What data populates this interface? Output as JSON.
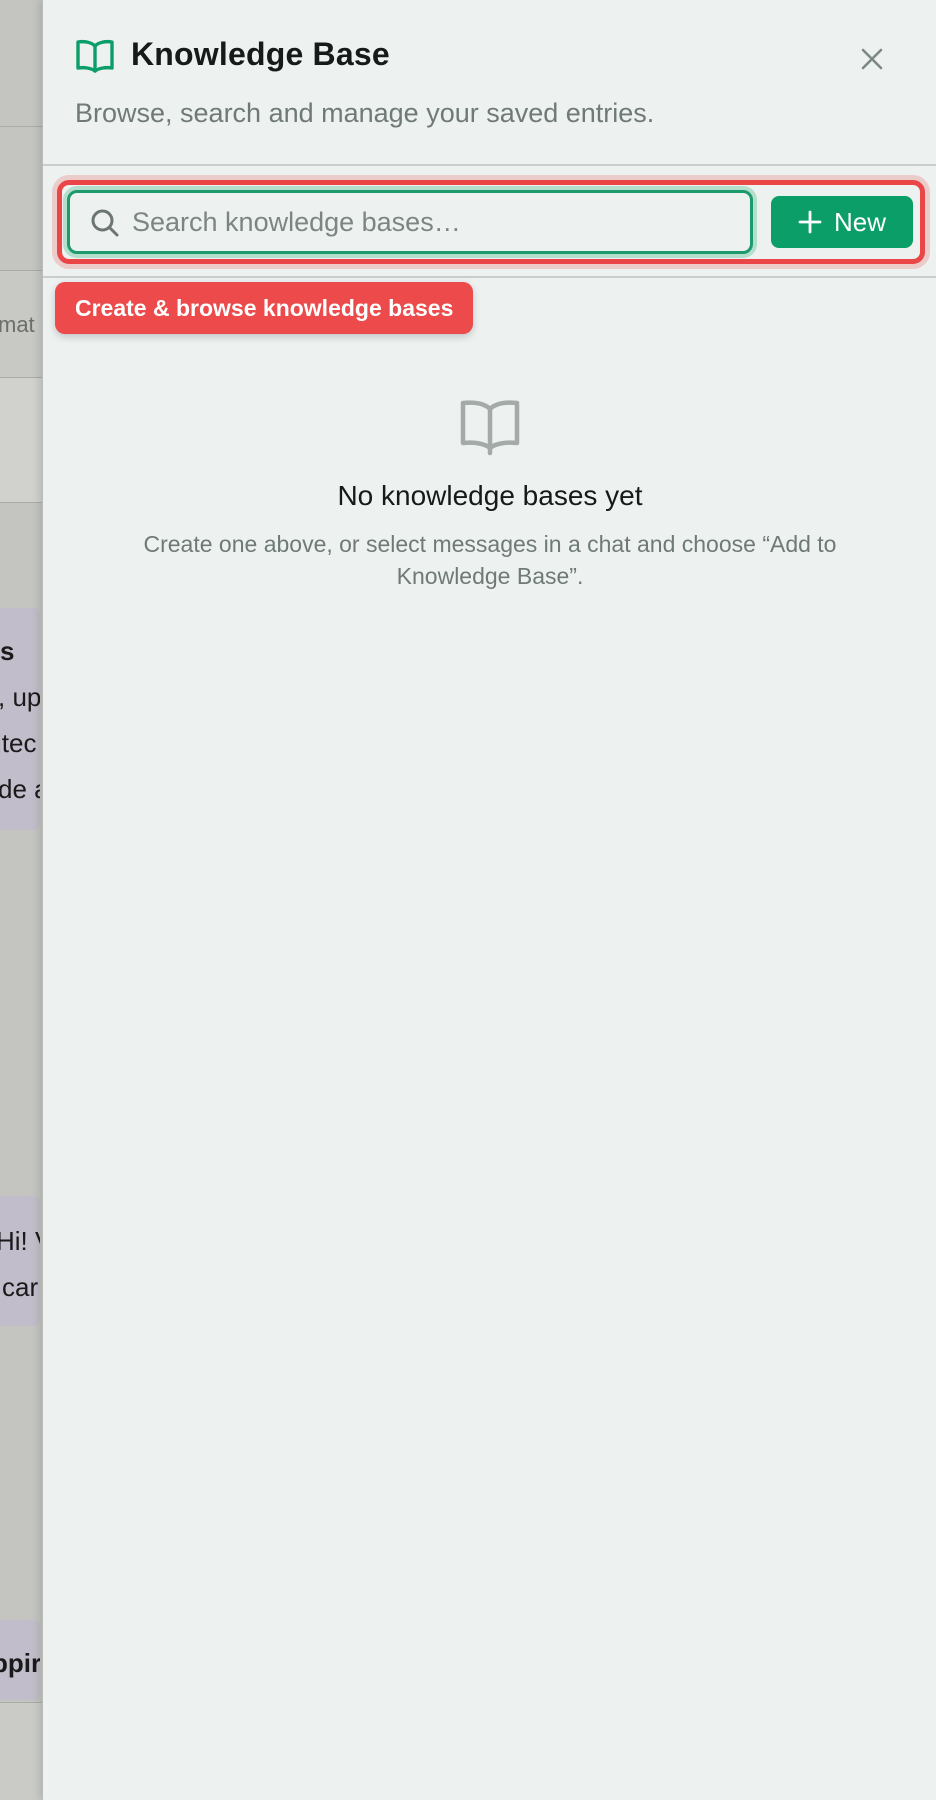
{
  "background_app": {
    "snippets": [
      "mat",
      "s",
      ", up",
      "itec",
      "de a",
      "Hi! V",
      "car",
      "ppir"
    ]
  },
  "drawer": {
    "title": "Knowledge Base",
    "subtitle": "Browse, search and manage your saved entries.",
    "title_icon": "book-open-icon",
    "close_icon": "close-icon",
    "accent_color": "#0b9e68"
  },
  "search": {
    "placeholder": "Search knowledge bases…",
    "value": "",
    "icon": "search-icon"
  },
  "new_button": {
    "label": "New",
    "icon": "plus-icon"
  },
  "tip": {
    "label": "Create & browse knowledge bases",
    "color": "#ec4a4b"
  },
  "empty_state": {
    "icon": "book-open-icon",
    "title": "No knowledge bases yet",
    "description": "Create one above, or select messages in a chat and choose “Add to Knowledge Base”."
  }
}
